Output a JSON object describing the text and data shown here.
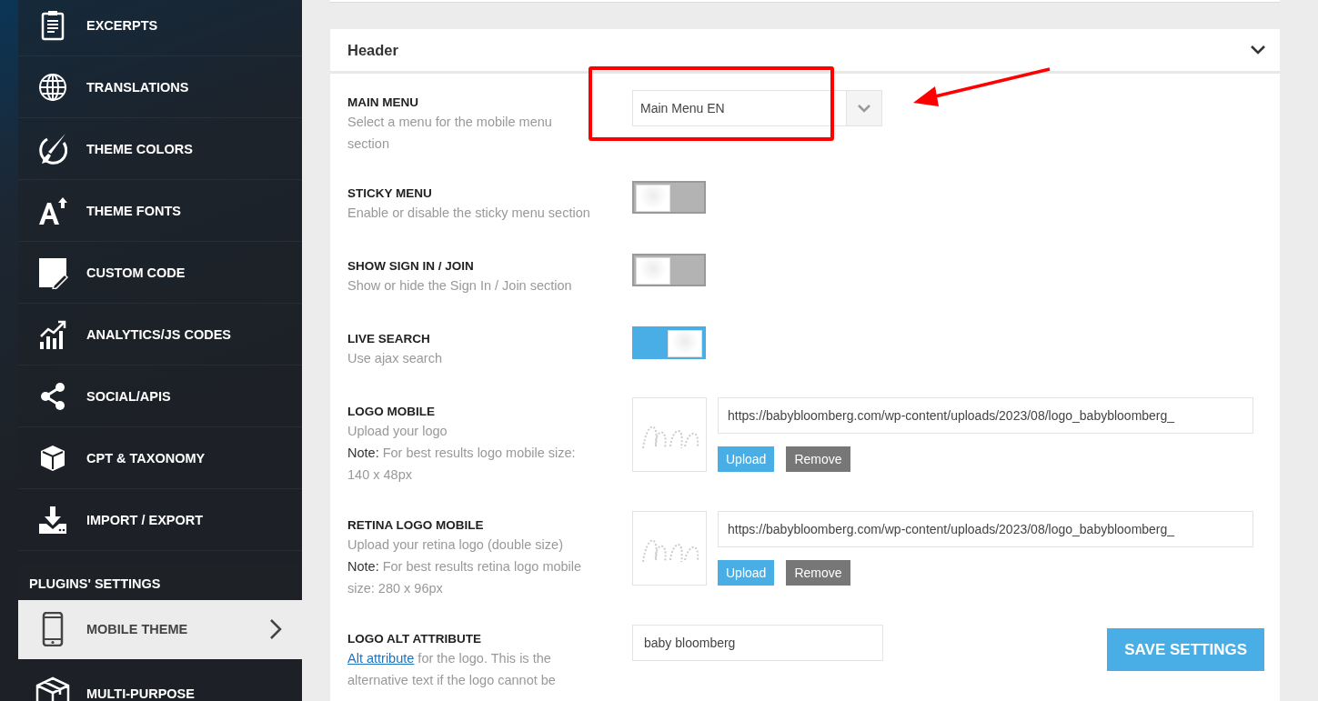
{
  "sidebar": {
    "items": [
      {
        "label": "EXCERPTS",
        "selected": false
      },
      {
        "label": "TRANSLATIONS",
        "selected": false
      },
      {
        "label": "THEME COLORS",
        "selected": false
      },
      {
        "label": "THEME FONTS",
        "selected": false
      },
      {
        "label": "CUSTOM CODE",
        "selected": false
      },
      {
        "label": "ANALYTICS/JS CODES",
        "selected": false
      },
      {
        "label": "SOCIAL/APIS",
        "selected": false
      },
      {
        "label": "CPT & TAXONOMY",
        "selected": false
      },
      {
        "label": "IMPORT / EXPORT",
        "selected": false
      }
    ],
    "section": "PLUGINS' SETTINGS",
    "plugin_items": [
      {
        "label": "MOBILE THEME",
        "selected": true
      },
      {
        "label": "MULTI-PURPOSE",
        "selected": false
      }
    ]
  },
  "panel": {
    "title": "Header",
    "expanded": true,
    "rows": [
      {
        "kind": "select",
        "label": "MAIN MENU",
        "description": "Select a menu for the mobile menu section",
        "value": "Main Menu EN"
      },
      {
        "kind": "toggle",
        "label": "STICKY MENU",
        "description": "Enable or disable the sticky menu section",
        "on": false
      },
      {
        "kind": "toggle",
        "label": "SHOW SIGN IN / JOIN",
        "description": "Show or hide the Sign In / Join section",
        "on": false
      },
      {
        "kind": "toggle",
        "label": "LIVE SEARCH",
        "description": "Use ajax search",
        "on": true
      },
      {
        "kind": "upload",
        "label": "LOGO MOBILE",
        "description": "Upload your logo",
        "note": "**Note:** For best results logo mobile size: 140 x 48px",
        "value": "https://babybloomberg.com/wp-content/uploads/2023/08/logo_babybloomberg_",
        "buttons": [
          "Upload",
          "Remove"
        ]
      },
      {
        "kind": "upload",
        "label": "RETINA LOGO MOBILE",
        "description": "Upload your retina logo (double size)",
        "note": "**Note:** For best results retina logo mobile size: 280 x 96px",
        "value": "https://babybloomberg.com/wp-content/uploads/2023/08/logo_babybloomberg_",
        "buttons": [
          "Upload",
          "Remove"
        ]
      },
      {
        "kind": "text",
        "label": "LOGO ALT ATTRIBUTE",
        "link": "Alt attribute",
        "description": "for the logo. This is the alternative text if the logo cannot be",
        "value": "baby bloomberg"
      }
    ],
    "save_button": "SAVE SETTINGS"
  }
}
